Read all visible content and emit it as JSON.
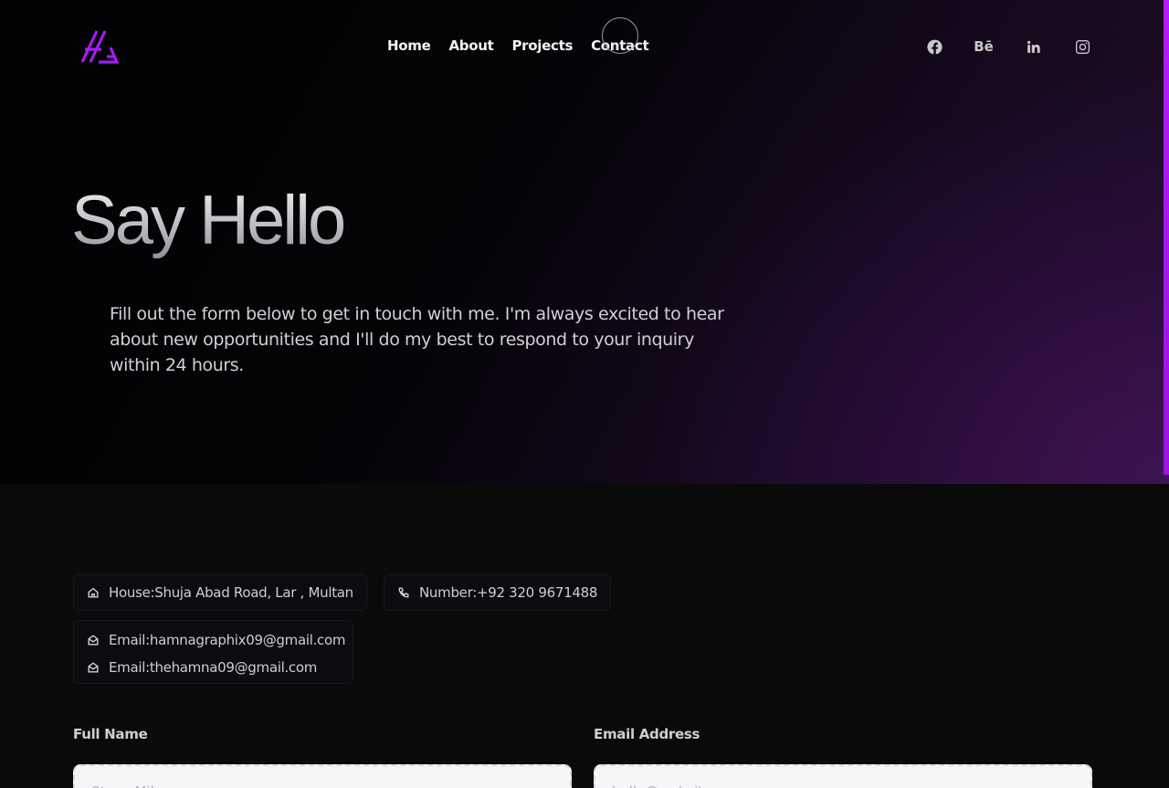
{
  "brand": {
    "logo_icon": "hg-triangle-logo-icon",
    "accent": "#a31cf0"
  },
  "nav": {
    "items": [
      {
        "label": "Home"
      },
      {
        "label": "About"
      },
      {
        "label": "Projects"
      },
      {
        "label": "Contact"
      }
    ]
  },
  "socials": {
    "facebook_icon": "facebook-icon",
    "behance_label": "Bē",
    "linkedin_label": "in",
    "instagram_icon": "instagram-icon"
  },
  "hero": {
    "title": "Say Hello",
    "description": "Fill out the form below to get in touch with me. I'm always excited to hear about new opportunities and I'll do my best to respond to your inquiry within 24 hours."
  },
  "contact_info": {
    "address": "House:Shuja Abad Road, Lar , Multan",
    "phone": "Number:+92 320 9671488",
    "emails": [
      "Email:hamnagraphix09@gmail.com",
      "Email:thehamna09@gmail.com"
    ]
  },
  "form": {
    "full_name_label": "Full Name",
    "full_name_placeholder": "Steve Milner",
    "email_label": "Email Address",
    "email_placeholder": "hello@website.com"
  }
}
